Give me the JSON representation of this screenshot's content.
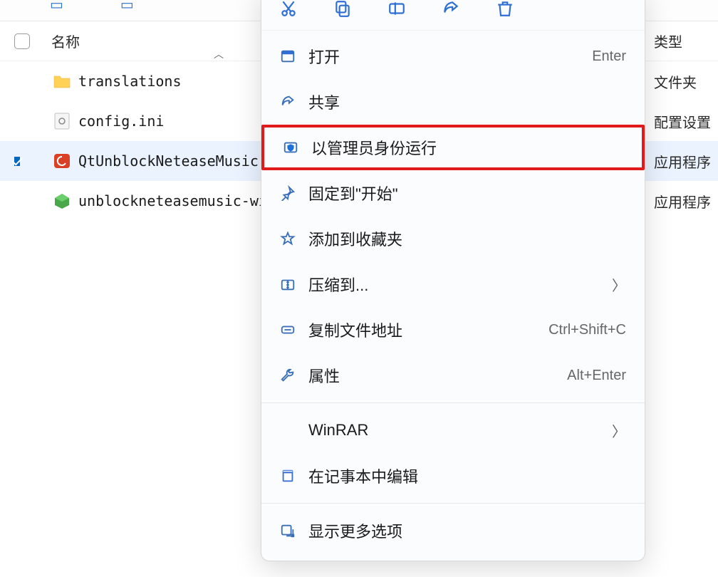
{
  "columns": {
    "name": "名称",
    "type": "类型"
  },
  "files": [
    {
      "name": "translations",
      "type": "文件夹",
      "kind": "folder",
      "selected": false
    },
    {
      "name": "config.ini",
      "type": "配置设置",
      "kind": "ini",
      "selected": false
    },
    {
      "name": "QtUnblockNeteaseMusic.e",
      "type": "应用程序",
      "kind": "exe-red",
      "selected": true
    },
    {
      "name": "unblockneteasemusic-win",
      "type": "应用程序",
      "kind": "exe-green",
      "selected": false
    }
  ],
  "context_menu": {
    "actions": [
      "cut",
      "copy",
      "rename",
      "share",
      "delete"
    ],
    "items": [
      {
        "icon": "open",
        "label": "打开",
        "accel": "Enter"
      },
      {
        "icon": "share",
        "label": "共享"
      },
      {
        "icon": "shield",
        "label": "以管理员身份运行",
        "highlighted": true
      },
      {
        "icon": "pin",
        "label": "固定到\"开始\""
      },
      {
        "icon": "star",
        "label": "添加到收藏夹"
      },
      {
        "icon": "zip",
        "label": "压缩到...",
        "submenu": true
      },
      {
        "icon": "path",
        "label": "复制文件地址",
        "accel": "Ctrl+Shift+C"
      },
      {
        "icon": "wrench",
        "label": "属性",
        "accel": "Alt+Enter"
      },
      {
        "sep": true
      },
      {
        "icon": "",
        "label": "WinRAR",
        "submenu": true
      },
      {
        "icon": "notepad",
        "label": "在记事本中编辑"
      },
      {
        "sep": true
      },
      {
        "icon": "more",
        "label": "显示更多选项"
      }
    ]
  }
}
